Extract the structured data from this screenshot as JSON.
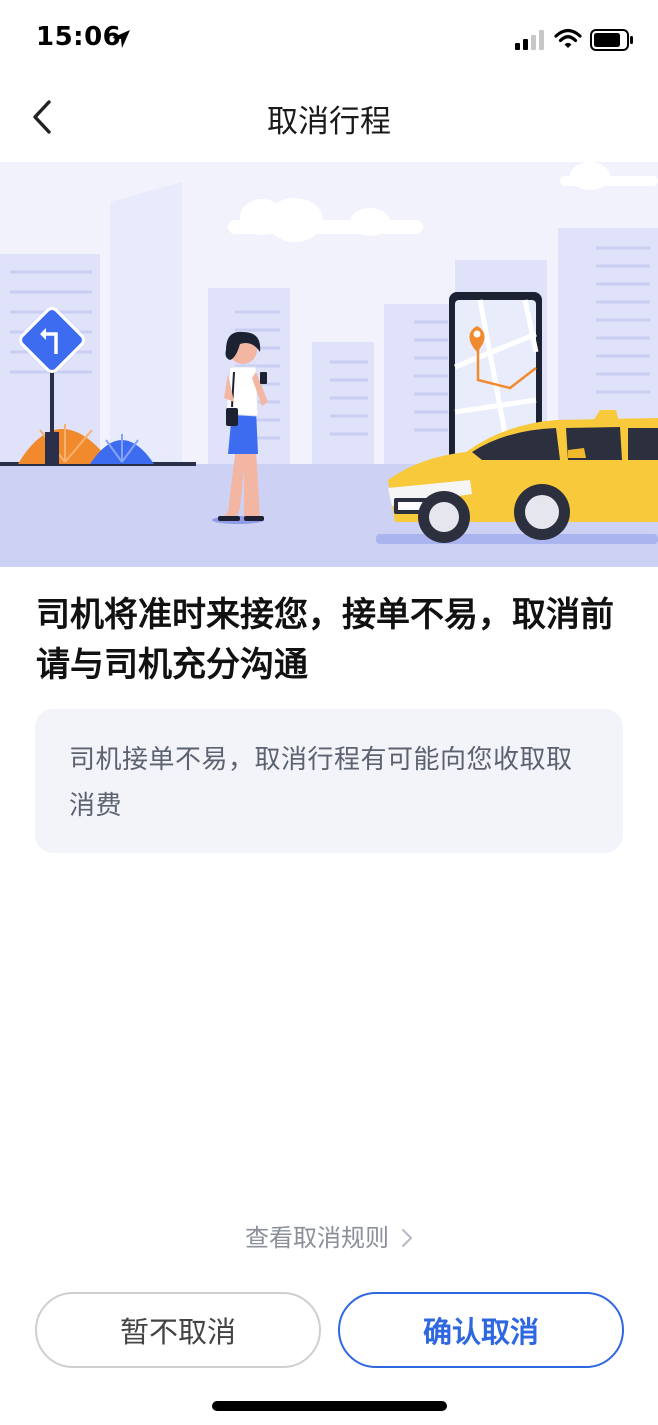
{
  "status_bar": {
    "time": "15:06",
    "icons": [
      "location-arrow-icon",
      "signal-icon",
      "wifi-icon",
      "battery-icon"
    ]
  },
  "nav": {
    "back_icon": "chevron-left-icon",
    "title": "取消行程"
  },
  "hero": {
    "description_icons": [
      "turn-sign-icon",
      "phone-map-icon",
      "taxi-icon",
      "woman-figure"
    ],
    "colors": {
      "sky": "#f1f2fb",
      "ground": "#cdd2f4",
      "taxi": "#f8c93a",
      "accent_orange": "#f08a2c",
      "accent_blue": "#3d6cf0"
    }
  },
  "headline": "司机将准时来接您，接单不易，取消前请与司机充分沟通",
  "notice": "司机接单不易，取消行程有可能向您收取取消费",
  "rules_link": "查看取消规则",
  "buttons": {
    "keep_label": "暂不取消",
    "confirm_label": "确认取消"
  },
  "colors": {
    "primary": "#2e67e0",
    "notice_bg": "#f3f4fa",
    "notice_text": "#5b6270"
  }
}
